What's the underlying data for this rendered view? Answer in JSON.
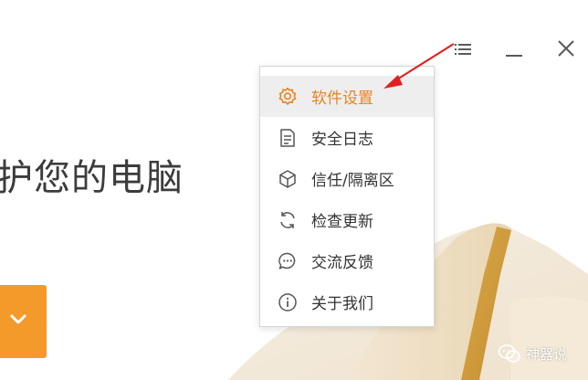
{
  "main": {
    "headline": "护您的电脑"
  },
  "menu": {
    "items": [
      {
        "label": "软件设置",
        "icon": "gear-icon",
        "active": true
      },
      {
        "label": "安全日志",
        "icon": "document-icon",
        "active": false
      },
      {
        "label": "信任/隔离区",
        "icon": "cube-icon",
        "active": false
      },
      {
        "label": "检查更新",
        "icon": "refresh-icon",
        "active": false
      },
      {
        "label": "交流反馈",
        "icon": "chat-bubble-icon",
        "active": false
      },
      {
        "label": "关于我们",
        "icon": "info-icon",
        "active": false
      }
    ]
  },
  "window_controls": {
    "icons": [
      "menu-list-icon",
      "minimize-icon",
      "close-icon"
    ]
  },
  "watermark": {
    "text": "神器说"
  },
  "colors": {
    "accent": "#f39a2a",
    "active_text": "#e8831f",
    "arrow": "#e02020"
  }
}
